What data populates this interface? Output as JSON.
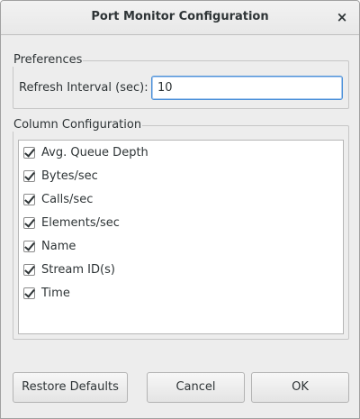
{
  "window": {
    "title": "Port Monitor Configuration",
    "close_glyph": "×"
  },
  "preferences": {
    "group_title": "Preferences",
    "refresh_label": "Refresh Interval (sec):",
    "refresh_value": "10"
  },
  "columns": {
    "group_title": "Column Configuration",
    "items": [
      {
        "label": "Avg. Queue Depth",
        "checked": true
      },
      {
        "label": "Bytes/sec",
        "checked": true
      },
      {
        "label": "Calls/sec",
        "checked": true
      },
      {
        "label": "Elements/sec",
        "checked": true
      },
      {
        "label": "Name",
        "checked": true
      },
      {
        "label": "Stream ID(s)",
        "checked": true
      },
      {
        "label": "Time",
        "checked": true
      }
    ]
  },
  "buttons": {
    "restore": "Restore Defaults",
    "cancel": "Cancel",
    "ok": "OK"
  }
}
